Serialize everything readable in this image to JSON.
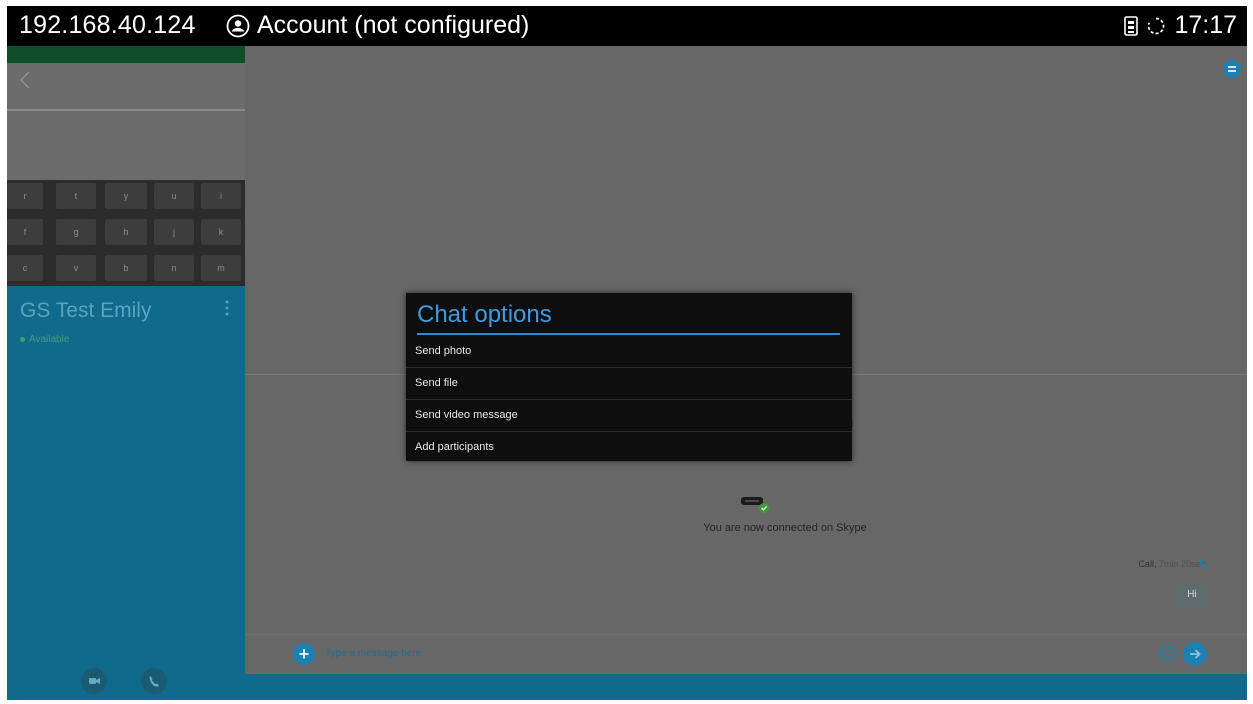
{
  "status_bar": {
    "ip_address": "192.168.40.124",
    "account_label": "Account (not configured)",
    "time": "17:17"
  },
  "sidebar": {
    "keyboard_rows": [
      [
        "r",
        "t",
        "y",
        "u",
        "i"
      ],
      [
        "f",
        "g",
        "h",
        "j",
        "k"
      ],
      [
        "c",
        "v",
        "b",
        "n",
        "m"
      ]
    ],
    "contact": {
      "name": "GS Test Emily",
      "status": "Available"
    }
  },
  "conversation": {
    "notice_faded": "Connect to your call",
    "notice_connected": "You are now connected on Skype",
    "call_label": "Call,",
    "call_duration": "7min 20sec",
    "message_bubble": "Hi",
    "input_placeholder": "Type a message here"
  },
  "dialog": {
    "title": "Chat options",
    "options": [
      {
        "label": "Send photo"
      },
      {
        "label": "Send file"
      },
      {
        "label": "Send video message"
      },
      {
        "label": "Add participants"
      }
    ]
  }
}
